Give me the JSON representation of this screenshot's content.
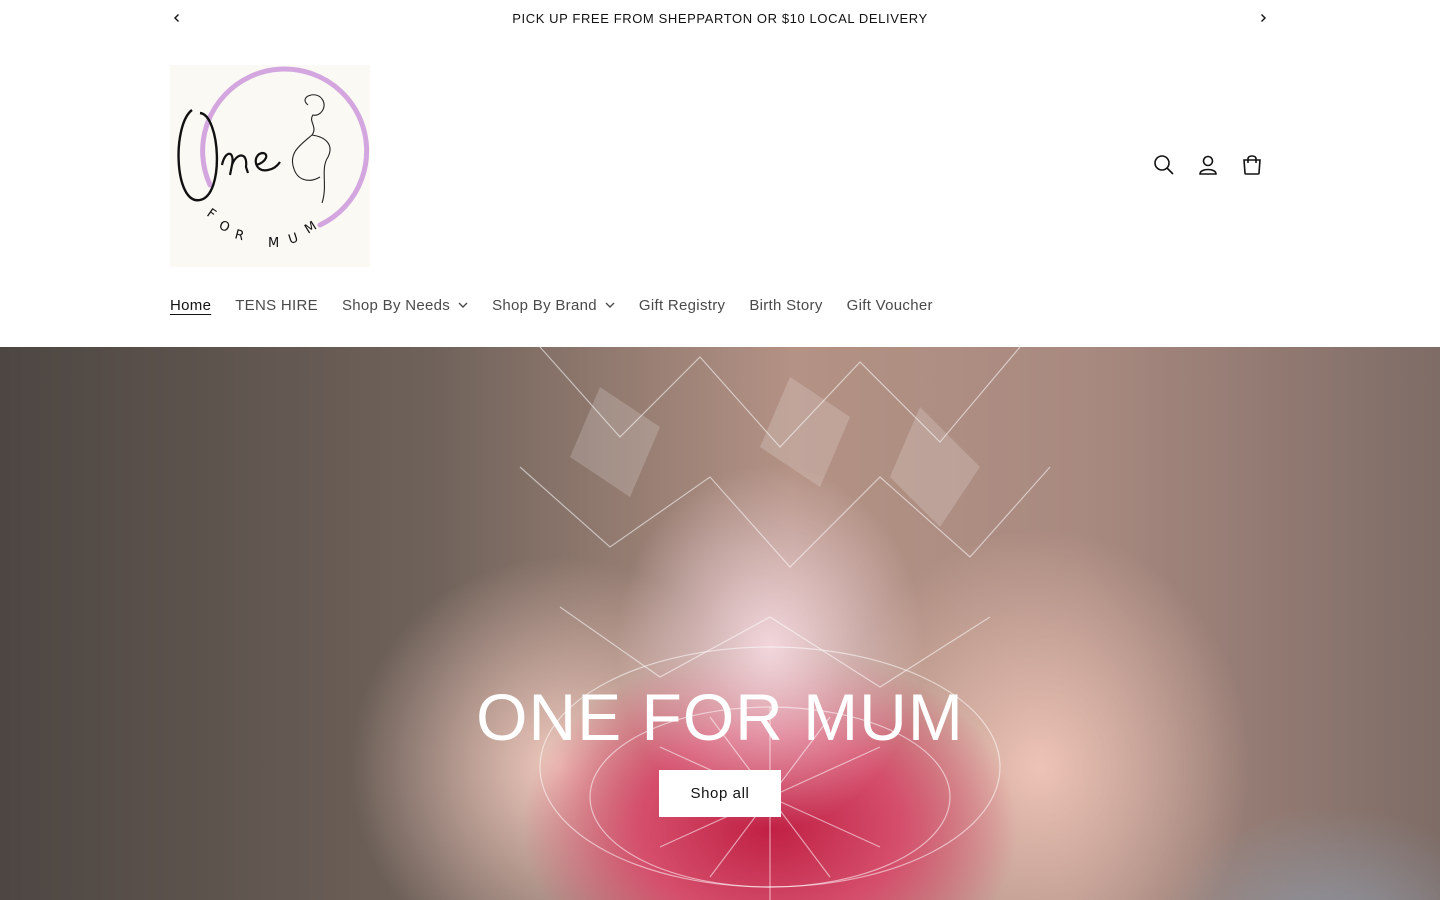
{
  "announcement": {
    "message": "PICK UP FREE FROM SHEPPARTON OR $10 LOCAL DELIVERY",
    "prev_icon": "chevron-left-icon",
    "next_icon": "chevron-right-icon"
  },
  "logo": {
    "script_text": "One",
    "sub_text": "FOR MUM",
    "ring_color": "#d4a6e0"
  },
  "header": {
    "icons": [
      "search-icon",
      "account-icon",
      "cart-icon"
    ]
  },
  "nav": {
    "items": [
      {
        "label": "Home",
        "active": true
      },
      {
        "label": "TENS HIRE"
      },
      {
        "label": "Shop By Needs",
        "has_dropdown": true
      },
      {
        "label": "Shop By Brand",
        "has_dropdown": true
      },
      {
        "label": "Gift Registry"
      },
      {
        "label": "Birth Story"
      },
      {
        "label": "Gift Voucher"
      }
    ]
  },
  "hero": {
    "title": "ONE FOR MUM",
    "button_label": "Shop all"
  },
  "colors": {
    "text": "#121212",
    "nav_text": "#4a4a4a",
    "button_bg": "#ffffff"
  }
}
